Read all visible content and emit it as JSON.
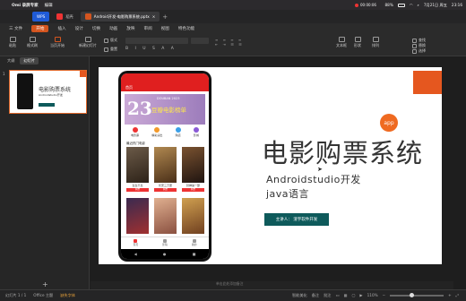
{
  "menubar": {
    "app": "Omi 录屏专家",
    "items": [
      "编辑"
    ],
    "status": [
      "88%",
      "7月21日 周五",
      "23:16"
    ],
    "center_time": "00:00:06"
  },
  "tabs": [
    {
      "label": "WPS",
      "active": false
    },
    {
      "label": "稻壳",
      "active": false
    },
    {
      "label": "Android开发-电影购票系统.pptx",
      "active": true
    }
  ],
  "menu": {
    "items": [
      "三 文件",
      "开始",
      "插入",
      "设计",
      "切换",
      "动画",
      "放映",
      "审阅",
      "视图",
      "特色功能"
    ],
    "selected": "开始"
  },
  "ribbon": {
    "left": [
      "粘贴",
      "格式刷",
      "当页开始",
      "新建幻灯片",
      "版式",
      "重置"
    ],
    "right": [
      "文本框",
      "形状",
      "排列",
      "查找",
      "替换",
      "选择"
    ]
  },
  "panel": {
    "tabs": [
      "大纲",
      "幻灯片"
    ],
    "active_tab": "幻灯片",
    "slide_number": "1",
    "add_symbol": "+"
  },
  "slide": {
    "title": "电影购票系统",
    "subtitle_line1": "Androidstudio开发",
    "subtitle_line2": "java语言",
    "badge": "app",
    "speaker": "主讲人：  渣宇软件开发",
    "phone": {
      "header": "首页",
      "banner_big": "23",
      "banner_brand": "DOUBAN 2023",
      "banner_text": "豆瓣电影榜单",
      "quick_icons": [
        "电影票",
        "精彩演出",
        "购店",
        "影城"
      ],
      "section_title": "最近热门电影",
      "movies": [
        {
          "name": "生生不息",
          "button": "购票",
          "color": "#4a3b2f"
        },
        {
          "name": "长安三万里",
          "button": "购票",
          "color": "#6b4a2a"
        },
        {
          "name": "封神第一部",
          "button": "购票",
          "color": "#3b2a22"
        },
        {
          "name": "",
          "button": "",
          "color": "#8a2a2a"
        },
        {
          "name": "",
          "button": "",
          "color": "#c98a6a"
        },
        {
          "name": "",
          "button": "",
          "color": "#b07a3a"
        }
      ],
      "tab_items": [
        "首页",
        "影院",
        "我的"
      ],
      "nav": [
        "◀",
        "●",
        "■"
      ]
    }
  },
  "notes_placeholder": "单击此处添加备注",
  "status": {
    "slide_info": "幻灯片 1 / 1",
    "theme": "Office 主题",
    "font_missing": "缺失字体",
    "beautify": "智能美化",
    "notes": "备注",
    "comment": "批注",
    "zoom": "110%"
  },
  "colors": {
    "accent": "#d4551f",
    "orange": "#e5571f",
    "teal": "#0e5a5b",
    "phone_red": "#e01f1f"
  }
}
